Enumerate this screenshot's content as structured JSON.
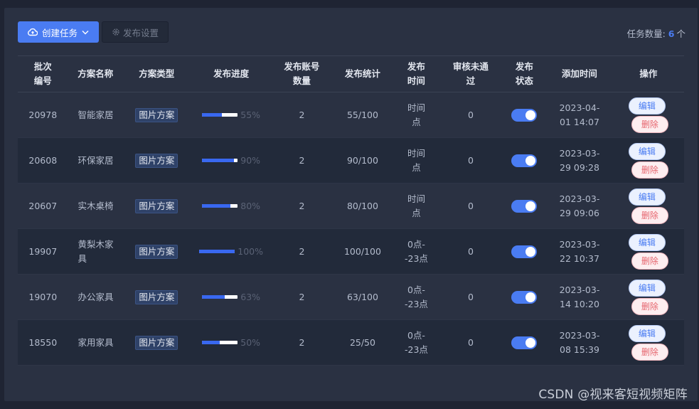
{
  "toolbar": {
    "create_label": "创建任务",
    "settings_label": "发布设置",
    "count_prefix": "任务数量:",
    "count_value": "6",
    "count_suffix": "个"
  },
  "table": {
    "headers": [
      "批次\n编号",
      "方案名称",
      "方案类型",
      "发布进度",
      "发布账号\n数量",
      "发布统计",
      "发布\n时间",
      "审核未通\n过",
      "发布\n状态",
      "添加时间",
      "操作"
    ],
    "rows": [
      {
        "id": "20978",
        "name": "智能家居",
        "type": "图片方案",
        "progress": 55,
        "progress_label": "55%",
        "accounts": "2",
        "stats": "55/100",
        "time": "时间\n点",
        "rejected": "0",
        "status_on": true,
        "added": "2023-04-\n01 14:07"
      },
      {
        "id": "20608",
        "name": "环保家居",
        "type": "图片方案",
        "progress": 90,
        "progress_label": "90%",
        "accounts": "2",
        "stats": "90/100",
        "time": "时间\n点",
        "rejected": "0",
        "status_on": true,
        "added": "2023-03-\n29 09:28"
      },
      {
        "id": "20607",
        "name": "实木桌椅",
        "type": "图片方案",
        "progress": 80,
        "progress_label": "80%",
        "accounts": "2",
        "stats": "80/100",
        "time": "时间\n点",
        "rejected": "0",
        "status_on": true,
        "added": "2023-03-\n29 09:06"
      },
      {
        "id": "19907",
        "name": "黄梨木家\n具",
        "type": "图片方案",
        "progress": 100,
        "progress_label": "100%",
        "accounts": "2",
        "stats": "100/100",
        "time": "0点-\n-23点",
        "rejected": "0",
        "status_on": true,
        "added": "2023-03-\n22 10:37"
      },
      {
        "id": "19070",
        "name": "办公家具",
        "type": "图片方案",
        "progress": 63,
        "progress_label": "63%",
        "accounts": "2",
        "stats": "63/100",
        "time": "0点-\n-23点",
        "rejected": "0",
        "status_on": true,
        "added": "2023-03-\n14 10:20"
      },
      {
        "id": "18550",
        "name": "家用家具",
        "type": "图片方案",
        "progress": 50,
        "progress_label": "50%",
        "accounts": "2",
        "stats": "25/50",
        "time": "0点-\n-23点",
        "rejected": "0",
        "status_on": true,
        "added": "2023-03-\n08 15:39"
      }
    ],
    "edit_label": "编辑",
    "delete_label": "删除"
  },
  "watermark": "CSDN @视来客短视频矩阵",
  "colors": {
    "accent": "#4a7cf2",
    "background": "#1f2433",
    "panel": "#2a3142",
    "danger": "#e6666f"
  }
}
